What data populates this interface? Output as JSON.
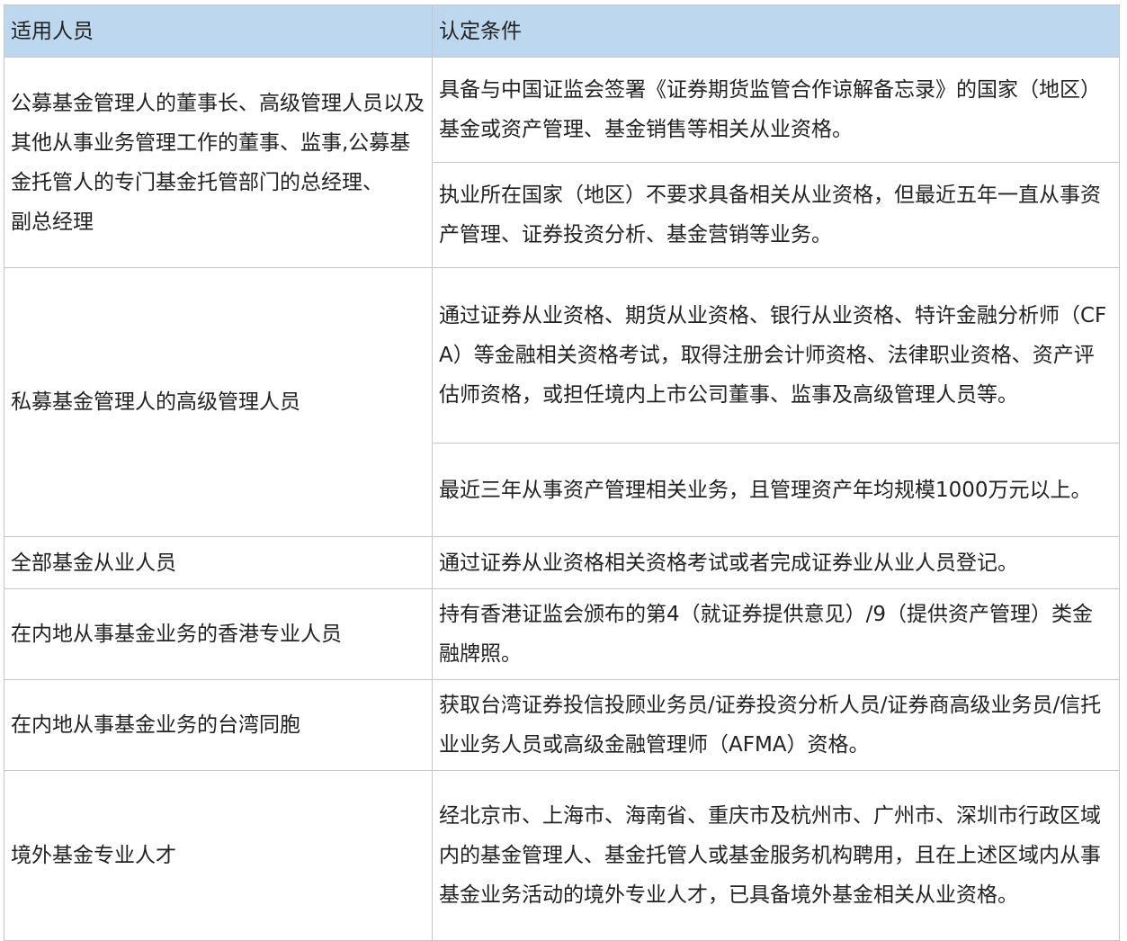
{
  "table": {
    "headers": [
      "适用人员",
      "认定条件"
    ],
    "rows": [
      {
        "person": "公募基金管理人的董事长、高级管理人员以及其他从事业务管理工作的董事、监事,公募基金托管人的专门基金托管部门的总经理、\n副总经理",
        "conditions": [
          "具备与中国证监会签署《证券期货监管合作谅解备忘录》的国家（地区）基金或资产管理、基金销售等相关从业资格。",
          "执业所在国家（地区）不要求具备相关从业资格，但最近五年一直从事资产管理、证券投资分析、基金营销等业务。"
        ]
      },
      {
        "person": "私募基金管理人的高级管理人员",
        "conditions": [
          "通过证券从业资格、期货从业资格、银行从业资格、特许金融分析师（CFA）等金融相关资格考试，取得注册会计师资格、法律职业资格、资产评估师资格，或担任境内上市公司董事、监事及高级管理人员等。",
          "最近三年从事资产管理相关业务，且管理资产年均规模1000万元以上。"
        ]
      },
      {
        "person": "全部基金从业人员",
        "conditions": [
          "通过证券从业资格相关资格考试或者完成证券业从业人员登记。"
        ]
      },
      {
        "person": "在内地从事基金业务的香港专业人员",
        "conditions": [
          "持有香港证监会颁布的第4（就证券提供意见）/9（提供资产管理）类金融牌照。"
        ]
      },
      {
        "person": "在内地从事基金业务的台湾同胞",
        "conditions": [
          "获取台湾证券投信投顾业务员/证券投资分析人员/证券商高级业务员/信托业业务人员或高级金融管理师（AFMA）资格。"
        ]
      },
      {
        "person": "境外基金专业人才",
        "conditions": [
          "经北京市、上海市、海南省、重庆市及杭州市、广州市、深圳市行政区域内的基金管理人、基金托管人或基金服务机构聘用，且在上述区域内从事基金业务活动的境外专业人才，已具备境外基金相关从业资格。"
        ]
      }
    ]
  }
}
